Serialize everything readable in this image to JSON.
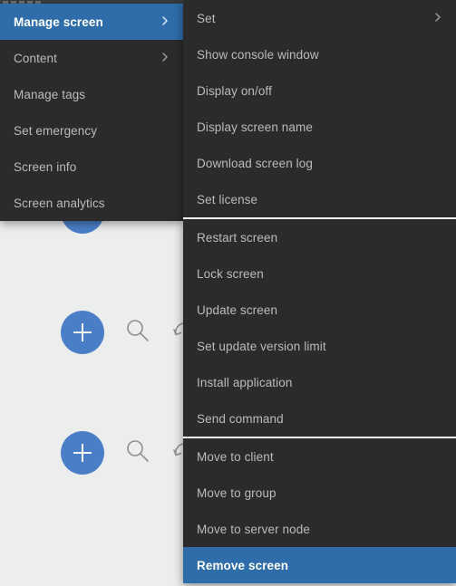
{
  "background": {
    "surface_color": "#eceded",
    "accent_color": "#4a7fc8",
    "rows": [
      {
        "add_label": "+",
        "search_icon": "magnifier-icon",
        "refresh_icon": "undo-arrow-icon"
      },
      {
        "add_label": "+",
        "search_icon": "magnifier-icon",
        "refresh_icon": "undo-arrow-icon"
      },
      {
        "add_label": "+",
        "search_icon": "magnifier-icon",
        "refresh_icon": "undo-arrow-icon"
      }
    ]
  },
  "colors": {
    "menu_background": "#2b2b2b",
    "menu_text": "#b9bbbd",
    "menu_highlight": "#2e6da9",
    "menu_highlight_text": "#ffffff",
    "separator": "#f4f5f6"
  },
  "context_menu": {
    "name": "screen-context-menu",
    "items": [
      {
        "label": "Manage screen",
        "submenu": true,
        "selected": true
      },
      {
        "label": "Content",
        "submenu": true,
        "selected": false
      },
      {
        "label": "Manage tags",
        "submenu": false,
        "selected": false
      },
      {
        "label": "Set emergency",
        "submenu": false,
        "selected": false
      },
      {
        "label": "Screen info",
        "submenu": false,
        "selected": false
      },
      {
        "label": "Screen analytics",
        "submenu": false,
        "selected": false
      }
    ]
  },
  "submenu": {
    "name": "manage-screen-submenu",
    "groups": [
      {
        "items": [
          {
            "label": "Set",
            "submenu": true,
            "selected": false
          },
          {
            "label": "Show console window",
            "submenu": false,
            "selected": false
          },
          {
            "label": "Display on/off",
            "submenu": false,
            "selected": false
          },
          {
            "label": "Display screen name",
            "submenu": false,
            "selected": false
          },
          {
            "label": "Download screen log",
            "submenu": false,
            "selected": false
          },
          {
            "label": "Set license",
            "submenu": false,
            "selected": false
          }
        ]
      },
      {
        "items": [
          {
            "label": "Restart screen",
            "submenu": false,
            "selected": false
          },
          {
            "label": "Lock screen",
            "submenu": false,
            "selected": false
          },
          {
            "label": "Update screen",
            "submenu": false,
            "selected": false
          },
          {
            "label": "Set update version limit",
            "submenu": false,
            "selected": false
          },
          {
            "label": "Install application",
            "submenu": false,
            "selected": false
          },
          {
            "label": "Send command",
            "submenu": false,
            "selected": false
          }
        ]
      },
      {
        "items": [
          {
            "label": "Move to client",
            "submenu": false,
            "selected": false
          },
          {
            "label": "Move to group",
            "submenu": false,
            "selected": false
          },
          {
            "label": "Move to server node",
            "submenu": false,
            "selected": false
          },
          {
            "label": "Remove screen",
            "submenu": false,
            "selected": true
          }
        ]
      }
    ]
  }
}
